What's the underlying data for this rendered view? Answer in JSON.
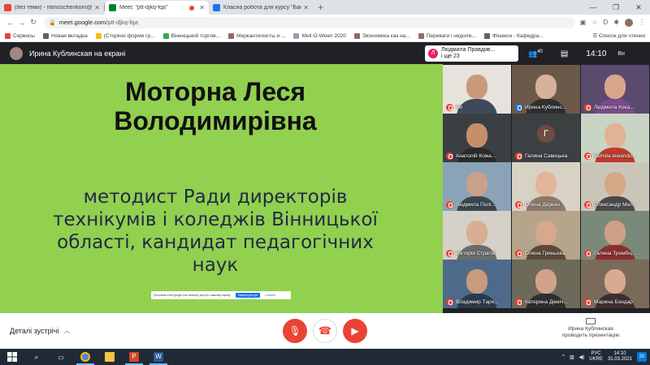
{
  "browser": {
    "tabs": [
      {
        "title": "(без теми) - ntimoschenkom@g",
        "favicon_color": "#ea4335",
        "active": false
      },
      {
        "title": "Meet: \"ptt-djkq-fqa\"",
        "favicon_color": "#00832d",
        "active": true
      },
      {
        "title": "Класна робота для курсу \"Бани",
        "favicon_color": "#1a73e8",
        "active": false
      }
    ],
    "new_tab_icon": "plus-icon",
    "address": {
      "domain": "meet.google.com",
      "path": "/ptt-djkq-fqa"
    },
    "bookmarks": [
      {
        "label": "Сервисы",
        "color": "#ea4335"
      },
      {
        "label": "Новая вкладка",
        "color": "#5f6368"
      },
      {
        "label": "(Сторінні форми гр...",
        "color": "#fbbc04"
      },
      {
        "label": "Вінницький торгов...",
        "color": "#34a853"
      },
      {
        "label": "Меркантилисты и ...",
        "color": "#8d6e63"
      },
      {
        "label": "Mell-O-Ween 2020",
        "color": "#9aa0a6"
      },
      {
        "label": "Экономика как на...",
        "color": "#8d6e63"
      },
      {
        "label": "Переваги і недолік...",
        "color": "#8d6e63"
      },
      {
        "label": "Фінанси - Кафедра...",
        "color": "#5f6368"
      }
    ],
    "reading_list": "Список для чтения"
  },
  "meet": {
    "presenter_banner": "Ирина Кублинская на екрані",
    "pinned": {
      "avatar_letter": "Л",
      "name": "Людмила Правдив...",
      "extra": "і ще 23",
      "color": "#e91e63"
    },
    "participant_count": "40",
    "clock": "14:10",
    "self_label": "Ви",
    "slide": {
      "name_line1": "Моторна Леся",
      "name_line2": "Володимирівна",
      "role_line1": "методист Ради директорів",
      "role_line2": "технікумів і коледжів Вінницької",
      "role_line3": "області, кандидат педагогічних",
      "role_line4": "наук",
      "share_text": "Програма meet.google.com виконує доступ к вашому екрану",
      "share_stop": "Закрити доступ",
      "share_hide": "Сховати"
    },
    "tiles": [
      {
        "name": "Ви",
        "bg": "#e6e2dc",
        "skin": "#c89a7a",
        "cloth": "#3e4a5a",
        "mic": "muted"
      },
      {
        "name": "Ирина Кублинс...",
        "bg": "#6b5a4a",
        "skin": "#d7b199",
        "cloth": "#2f2f2f",
        "mic": "speaking"
      },
      {
        "name": "Людмила Кока...",
        "bg": "#5a4b6e",
        "skin": "#d9a58a",
        "cloth": "#7b4a8c",
        "mic": "muted"
      },
      {
        "name": "Анатолій Кожа...",
        "bg": "#3a3f44",
        "skin": "#c68f6c",
        "cloth": "#2a2a2a",
        "mic": "muted"
      },
      {
        "name": "Галина Савицька",
        "bg": "#3c4043",
        "letter": "Г",
        "letter_bg": "#6d4c41",
        "mic": "muted"
      },
      {
        "name": "ludmila lewando...",
        "bg": "#c8d4c4",
        "skin": "#e0b394",
        "cloth": "#c0392b",
        "mic": "muted"
      },
      {
        "name": "Людмила Полі...",
        "bg": "#8aa3b8",
        "skin": "#caa08a",
        "cloth": "#37474f",
        "mic": "muted"
      },
      {
        "name": "Олена Деркач",
        "bg": "#d8d2c4",
        "skin": "#e2b49a",
        "cloth": "#8b7a6a",
        "mic": "muted"
      },
      {
        "name": "Олександр Мел...",
        "bg": "#c9c6b9",
        "skin": "#d7a888",
        "cloth": "#4a4a4a",
        "mic": "muted"
      },
      {
        "name": "Вікторія Стратій",
        "bg": "#d5d0c8",
        "skin": "#d9ad92",
        "cloth": "#6b6b6b",
        "mic": "muted"
      },
      {
        "name": "Олена Гриньова",
        "bg": "#b7a48c",
        "skin": "#d6a88c",
        "cloth": "#5d4a3a",
        "mic": "muted"
      },
      {
        "name": "Галина Трембіц...",
        "bg": "#7a8a7a",
        "skin": "#cf9f86",
        "cloth": "#8e2d2d",
        "mic": "muted"
      },
      {
        "name": "Владимир Тарн...",
        "bg": "#4e6a8a",
        "skin": "#c99a7d",
        "cloth": "#2b3a4a",
        "mic": "muted"
      },
      {
        "name": "Катерина Деміч...",
        "bg": "#6d6a5a",
        "skin": "#d2a38a",
        "cloth": "#2e2e2e",
        "mic": "muted"
      },
      {
        "name": "Марина Бондар",
        "bg": "#7a6a5a",
        "skin": "#d8aa90",
        "cloth": "#3e2e2e",
        "mic": "muted"
      }
    ],
    "details_label": "Деталі зустрічі",
    "presenting_line1": "Ирина Кублинская",
    "presenting_line2": "проводить презентацію"
  },
  "taskbar": {
    "apps": [
      {
        "name": "chrome",
        "color": "#4285f4",
        "active": true
      },
      {
        "name": "explorer",
        "color": "#f4c542",
        "active": false
      },
      {
        "name": "powerpoint",
        "color": "#d24726",
        "active": true
      },
      {
        "name": "word",
        "color": "#2b579a",
        "active": true
      }
    ],
    "lang_line1": "РУС",
    "lang_line2": "UKRE",
    "time": "14:10",
    "date": "31.03.2021",
    "notifications": "20"
  }
}
